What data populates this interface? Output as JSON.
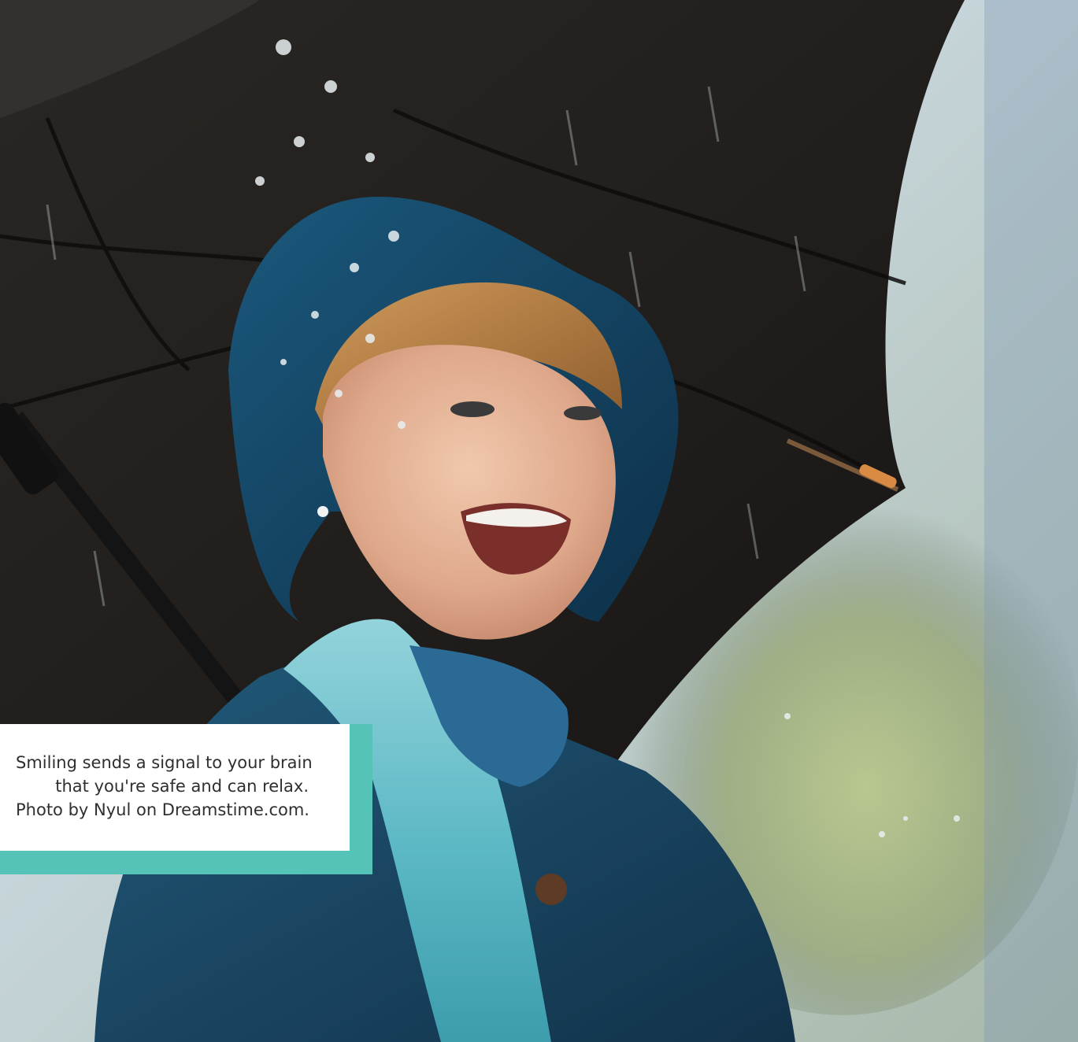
{
  "photo": {
    "alt": "Laughing woman in a blue rain hat and scarf holding a black umbrella in the rain",
    "subject": "smiling-woman-under-umbrella",
    "colors": {
      "umbrella": "#1f1c1a",
      "hat": "#123f5a",
      "scarf": "#5bb8c4",
      "coat": "#1a4461",
      "background_blur": "#c9d6cf",
      "skin": "#e3b091",
      "hair": "#b1743d",
      "accent": "#56c3b8"
    }
  },
  "caption": {
    "line1": "Smiling sends a signal to your brain",
    "line2": "that you're safe and can relax.",
    "line3": "Photo by Nyul on Dreamstime.com."
  }
}
